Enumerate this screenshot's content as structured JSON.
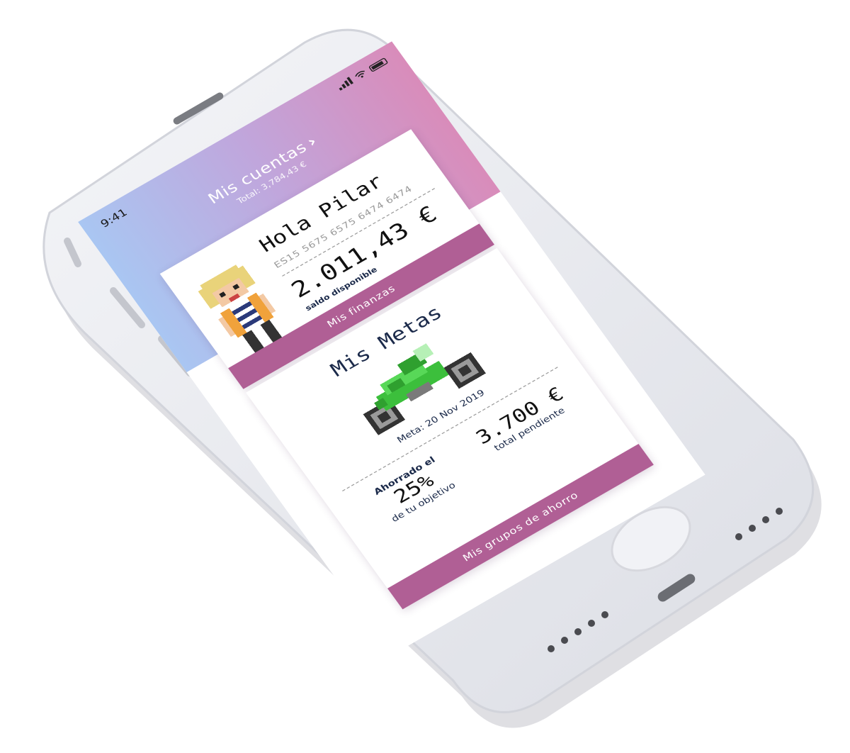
{
  "status_bar": {
    "time": "9:41"
  },
  "accounts": {
    "title": "Mis cuentas",
    "chevron": "›",
    "total": "Total: 3,784,43 €"
  },
  "user_card": {
    "greeting": "Hola Pilar",
    "iban": "ES15 5675 6575 6474 6474",
    "balance": "2.011,43 €",
    "balance_label": "saldo disponible",
    "button_label": "Mis finanzas",
    "avatar_icon": "pixel-person-icon"
  },
  "goals_card": {
    "title": "Mis Metas",
    "goal_icon": "pixel-motorbike-icon",
    "goal_date": "Meta: 20 Nov 2019",
    "saved_prefix": "Ahorrado el",
    "saved_percent": "25%",
    "saved_suffix": "de tu objetivo",
    "pending_amount": "3.700 €",
    "pending_label": "total pendiente",
    "button_label": "Mis grupos de ahorro"
  },
  "colors": {
    "accent": "#b05f95",
    "gradient_start": "#a9c6f2",
    "gradient_end": "#d98cba",
    "text_dark": "#1b2a4a"
  }
}
